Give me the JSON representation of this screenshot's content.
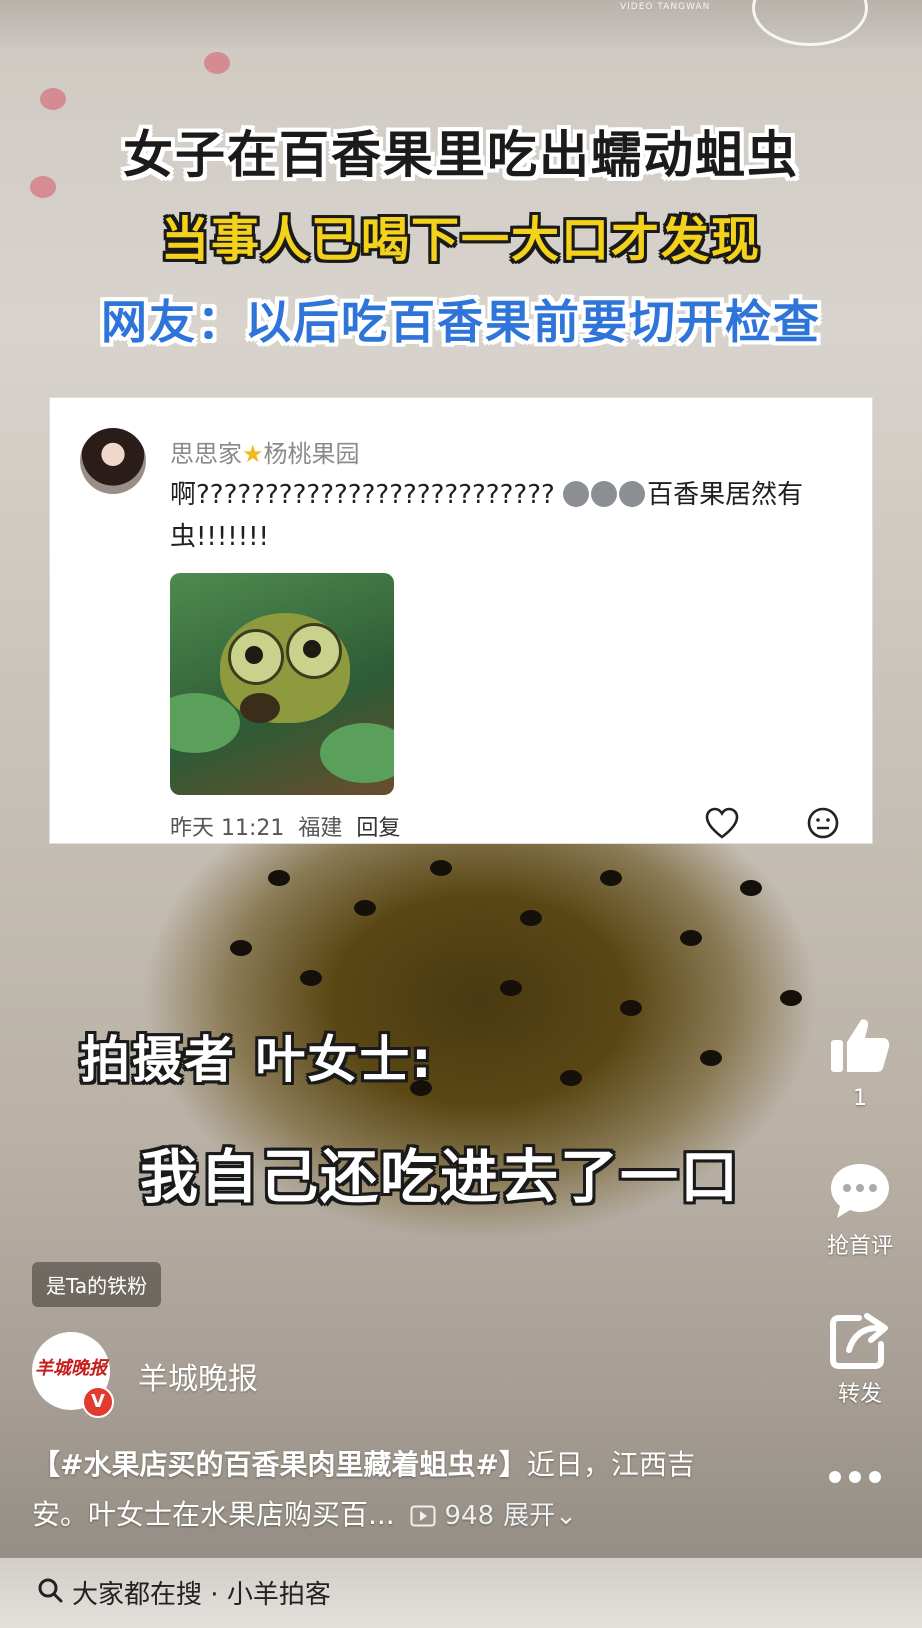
{
  "watermark": "VIDEO TANGWAN",
  "headline": {
    "line1": "女子在百香果里吃出蠕动蛆虫",
    "line2": "当事人已喝下一大口才发现",
    "line3": "网友：以后吃百香果前要切开检查"
  },
  "comment": {
    "author": "思思家",
    "author_suffix": "杨桃果园",
    "text_start": "啊?????????????????????????? ",
    "text_end": "百香果居然有虫!!!!!!!",
    "time": "昨天 11:21",
    "location": "福建",
    "reply_label": "回复"
  },
  "subtitle": {
    "line1": "拍摄者 叶女士:",
    "line2": "我自己还吃进去了一口"
  },
  "sidebar": {
    "like_count": "1",
    "comment_label": "抢首评",
    "share_label": "转发"
  },
  "fan_badge": "是Ta的铁粉",
  "channel": {
    "logo_text": "羊城晚报",
    "name": "羊城晚报"
  },
  "description": {
    "hashtag": "【#水果店买的百香果肉里藏着蛆虫#】",
    "text": "近日，江西吉安。叶女士在水果店购买百...",
    "plays": "948",
    "expand": "展开"
  },
  "bottom_search": {
    "prefix": "大家都在搜",
    "query": "小羊拍客"
  }
}
